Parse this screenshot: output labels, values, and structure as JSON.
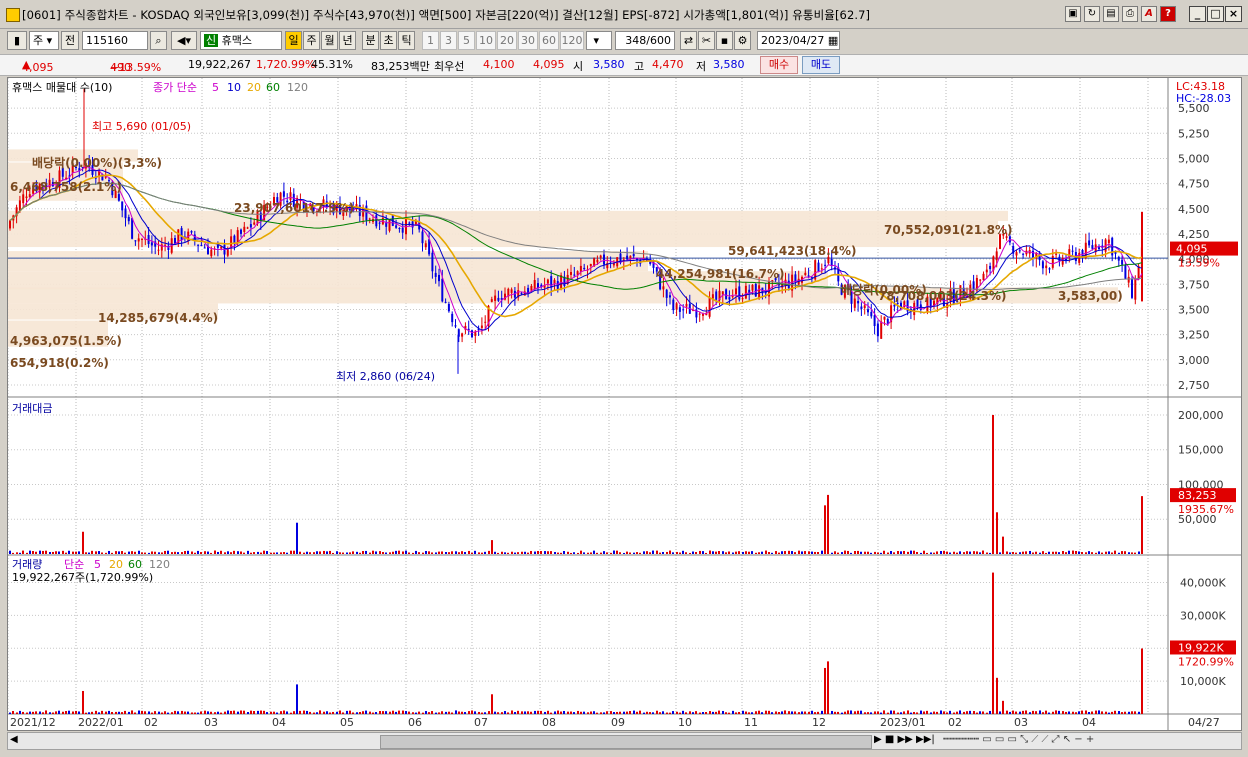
{
  "title": "[0601] 주식종합차트 - KOSDAQ 외국인보유[3,099(천)] 주식수[43,970(천)] 액면[500] 자본금[220(억)] 결산[12월] EPS[-872] 시가총액[1,801(억)] 유통비율[62.7]",
  "toolbar": {
    "market": "주",
    "prev": "전",
    "code": "115160",
    "name_prefix": "신",
    "name": "휴맥스",
    "periods": [
      "일",
      "주",
      "월",
      "년",
      "분",
      "초",
      "틱"
    ],
    "numbers": [
      "1",
      "3",
      "5",
      "10",
      "20",
      "30",
      "60",
      "120"
    ],
    "count": "348",
    "count_max": "/600",
    "date": "2023/04/27"
  },
  "quote": {
    "price": "4,095",
    "change": "490",
    "change_pct": "+13.59%",
    "volume": "19,922,267",
    "volume_pct": "1,720.99%",
    "turnover": "45.31%",
    "amount": "83,253백만",
    "best_label": "최우선",
    "best_ask": "4,100",
    "best_bid": "4,095",
    "open_label": "시",
    "open": "3,580",
    "high_label": "고",
    "high": "4,470",
    "low_label": "저",
    "low": "3,580",
    "buy_button": "매수",
    "sell_button": "매도"
  },
  "price_panel": {
    "title": "휴맥스 매물대 수(10)",
    "ma_label": "종가 단순",
    "ma_periods": [
      "5",
      "10",
      "20",
      "60",
      "120"
    ],
    "ma_colors": [
      "#cc00cc",
      "#0000cc",
      "#e6a800",
      "#008000",
      "#7f7f7f"
    ],
    "lc": "LC:43.18",
    "hc": "HC:-28.03",
    "current_price_tag": "4,095",
    "current_pct_tag": "13.59%",
    "high_marker": "최고 5,690 (01/05)",
    "low_marker": "최저 2,860 (06/24)",
    "volume_profile_labels": [
      "배당락(0.00%)(3,3%)",
      "6,468,758(2.1%)",
      "23,907,601(7.9%)",
      "70,552,091(21.8%)",
      "59,641,423(18.4%)",
      "44,254,981(16.7%)",
      "78,708,003(24.3%)",
      "3,583.00",
      "14,285,679(4.4%)",
      "4,963,075(1.5%)",
      "654,918(0.2%)",
      "배당락(0.00%)",
      "3,583,00)"
    ],
    "y_ticks": [
      "5,500",
      "5,250",
      "5,000",
      "4,750",
      "4,500",
      "4,250",
      "4,000",
      "3,750",
      "3,500",
      "3,250",
      "3,000",
      "2,750"
    ]
  },
  "amount_panel": {
    "title": "거래대금",
    "y_ticks": [
      "200,000",
      "150,000",
      "100,000",
      "50,000"
    ],
    "value_tag": "83,253",
    "pct_tag": "1935.67%"
  },
  "volume_panel": {
    "title": "거래량",
    "ma_label": "단순",
    "ma_periods": [
      "5",
      "20",
      "60",
      "120"
    ],
    "sub": "19,922,267주(1,720.99%)",
    "y_ticks": [
      "40,000K",
      "30,000K",
      "20,000K",
      "10,000K"
    ],
    "value_tag": "19,922K",
    "pct_tag": "1720.99%"
  },
  "x_axis": [
    "2021/12",
    "2022/01",
    "02",
    "03",
    "04",
    "05",
    "06",
    "07",
    "08",
    "09",
    "10",
    "11",
    "12",
    "2023/01",
    "02",
    "03",
    "04",
    "04/27"
  ],
  "colors": {
    "up": "#e00000",
    "down": "#0000e0",
    "bg": "#d4d0c8"
  }
}
